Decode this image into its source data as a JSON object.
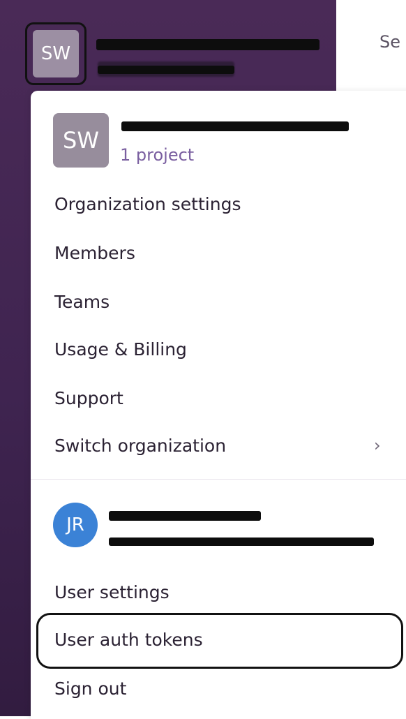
{
  "header": {
    "avatar_initials": "SW",
    "topbar_text": "Se"
  },
  "org": {
    "avatar_initials": "SW",
    "project_count": "1 project"
  },
  "menu": {
    "organization_settings": "Organization settings",
    "members": "Members",
    "teams": "Teams",
    "usage_billing": "Usage & Billing",
    "support": "Support",
    "switch_organization": "Switch organization",
    "switch_chevron": "›"
  },
  "user": {
    "avatar_initials": "JR",
    "user_settings": "User settings",
    "user_auth_tokens": "User auth tokens",
    "sign_out": "Sign out"
  },
  "colors": {
    "sidebar": "#4a2a57",
    "accent_purple": "#7a5fa0",
    "user_avatar": "#3b82d6"
  }
}
